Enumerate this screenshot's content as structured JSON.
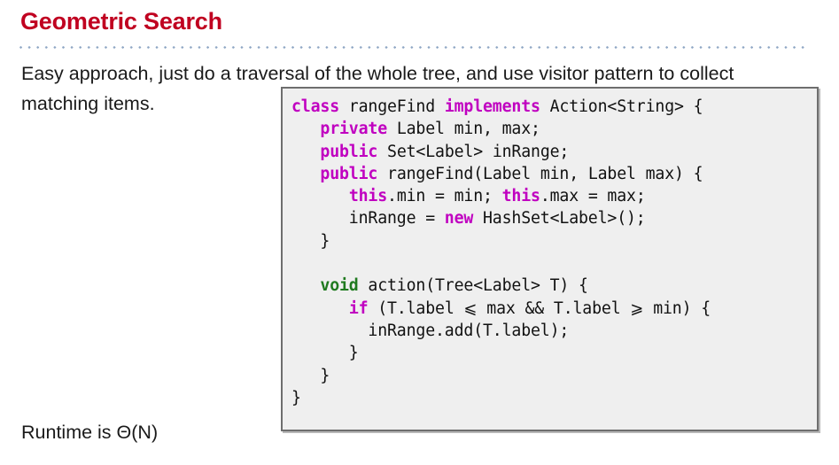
{
  "slide": {
    "title": "Geometric Search",
    "title_color": "#c00020",
    "rule_color": "#8ea6c4",
    "background": "#ffffff"
  },
  "body": {
    "paragraph": "Easy approach, just do a traversal of the whole tree, and use visitor pattern to collect matching items."
  },
  "runtime": {
    "text": "Runtime is Θ(N)"
  },
  "code_block": {
    "background": "#efefef",
    "border_color": "#6e6e6e",
    "keyword_color": "#c000c0",
    "type_color": "#1f7a1f",
    "text_color": "#111111",
    "language": "Java",
    "lines": [
      "class rangeFind implements Action<String> {",
      "   private Label min, max;",
      "   public Set<Label> inRange;",
      "   public rangeFind(Label min, Label max) {",
      "      this.min = min; this.max = max;",
      "      inRange = new HashSet<Label>();",
      "   }",
      "",
      "   void action(Tree<Label> T) {",
      "      if (T.label ⩽ max && T.label ⩾ min) {",
      "        inRange.add(T.label);",
      "      }",
      "   }",
      "}"
    ],
    "tokens": [
      [
        {
          "t": "class",
          "c": "kw"
        },
        {
          "t": " rangeFind ",
          "c": "pl"
        },
        {
          "t": "implements",
          "c": "kw"
        },
        {
          "t": " Action<String> {",
          "c": "pl"
        }
      ],
      [
        {
          "t": "   ",
          "c": "pl"
        },
        {
          "t": "private",
          "c": "kw"
        },
        {
          "t": " Label min, max;",
          "c": "pl"
        }
      ],
      [
        {
          "t": "   ",
          "c": "pl"
        },
        {
          "t": "public",
          "c": "kw"
        },
        {
          "t": " Set<Label> inRange;",
          "c": "pl"
        }
      ],
      [
        {
          "t": "   ",
          "c": "pl"
        },
        {
          "t": "public",
          "c": "kw"
        },
        {
          "t": " rangeFind(Label min, Label max) {",
          "c": "pl"
        }
      ],
      [
        {
          "t": "      ",
          "c": "pl"
        },
        {
          "t": "this",
          "c": "kw"
        },
        {
          "t": ".min = min; ",
          "c": "pl"
        },
        {
          "t": "this",
          "c": "kw"
        },
        {
          "t": ".max = max;",
          "c": "pl"
        }
      ],
      [
        {
          "t": "      inRange = ",
          "c": "pl"
        },
        {
          "t": "new",
          "c": "kw"
        },
        {
          "t": " HashSet<Label>();",
          "c": "pl"
        }
      ],
      [
        {
          "t": "   }",
          "c": "pl"
        }
      ],
      [
        {
          "t": "",
          "c": "pl"
        }
      ],
      [
        {
          "t": "   ",
          "c": "pl"
        },
        {
          "t": "void",
          "c": "ty"
        },
        {
          "t": " action(Tree<Label> T) {",
          "c": "pl"
        }
      ],
      [
        {
          "t": "      ",
          "c": "pl"
        },
        {
          "t": "if",
          "c": "kw"
        },
        {
          "t": " (T.label ⩽ max && T.label ⩾ min) {",
          "c": "pl"
        }
      ],
      [
        {
          "t": "        inRange.add(T.label);",
          "c": "pl"
        }
      ],
      [
        {
          "t": "      }",
          "c": "pl"
        }
      ],
      [
        {
          "t": "   }",
          "c": "pl"
        }
      ],
      [
        {
          "t": "}",
          "c": "pl"
        }
      ]
    ]
  }
}
